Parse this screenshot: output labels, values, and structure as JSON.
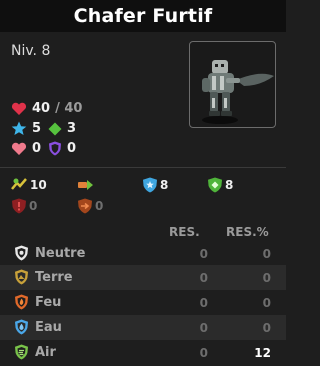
{
  "header": {
    "title": "Chafer Furtif"
  },
  "level": "Niv. 8",
  "stats": {
    "hp": {
      "value": "40",
      "max": "/ 40",
      "icon": "heart-red-icon"
    },
    "ap": {
      "value": "5",
      "icon": "star-blue-icon"
    },
    "mp": {
      "value": "3",
      "icon": "diamond-green-icon"
    },
    "shield_heal": {
      "value": "0",
      "icon": "heart-pink-icon"
    },
    "shield": {
      "value": "0",
      "icon": "shield-purple-icon"
    }
  },
  "secondary": [
    {
      "value": "10",
      "icon": "dodge-ap-icon",
      "active": true
    },
    {
      "value": "",
      "icon": "dodge-mp-icon",
      "active": true
    },
    {
      "value": "8",
      "icon": "water-resist-ap-icon",
      "active": true
    },
    {
      "value": "8",
      "icon": "air-resist-mp-icon",
      "active": true
    },
    {
      "value": "0",
      "icon": "red-shield-icon",
      "active": false
    },
    {
      "value": "0",
      "icon": "orange-shield-icon",
      "active": false
    }
  ],
  "resistances": {
    "headers": [
      "RES.",
      "RES.%"
    ],
    "rows": [
      {
        "name": "Neutre",
        "res": "0",
        "pct": "0",
        "color": "#e8e8e8"
      },
      {
        "name": "Terre",
        "res": "0",
        "pct": "0",
        "color": "#c8a13a"
      },
      {
        "name": "Feu",
        "res": "0",
        "pct": "0",
        "color": "#e0692a"
      },
      {
        "name": "Eau",
        "res": "0",
        "pct": "0",
        "color": "#4aa7e8"
      },
      {
        "name": "Air",
        "res": "0",
        "pct": "12",
        "color": "#79c34a"
      }
    ]
  }
}
